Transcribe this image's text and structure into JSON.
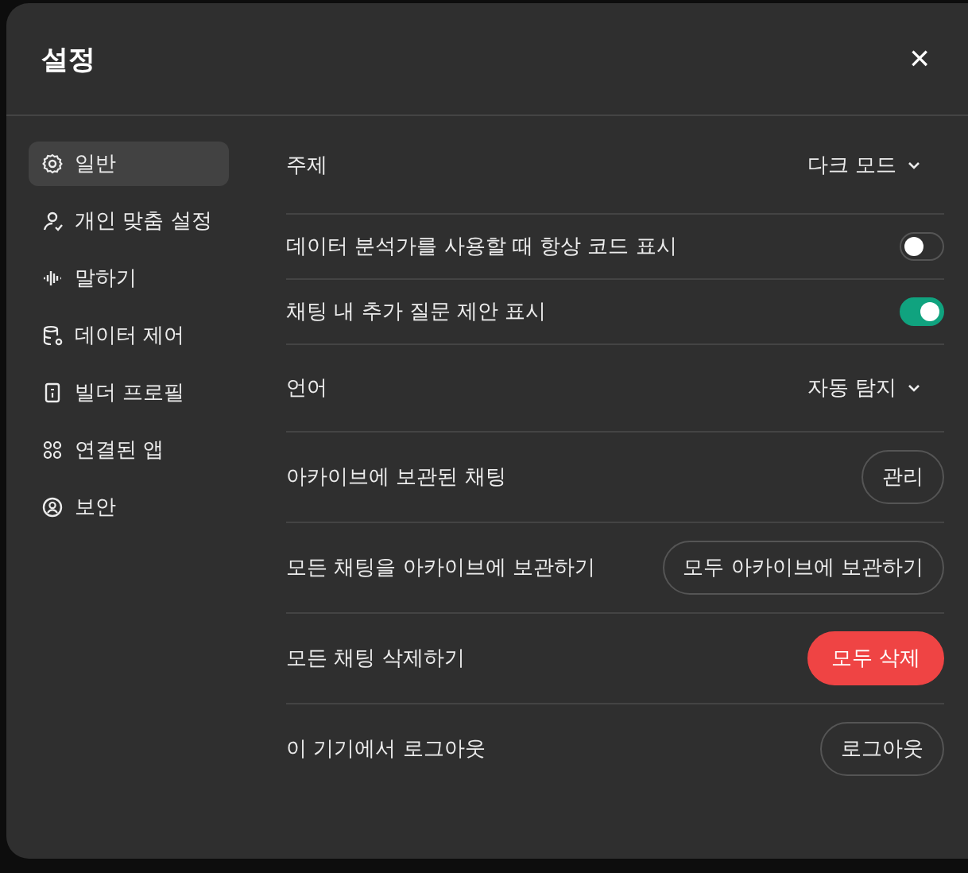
{
  "dialog": {
    "title": "설정",
    "close": "×"
  },
  "sidebar": {
    "items": [
      {
        "label": "일반",
        "kind": "gear",
        "selected": true
      },
      {
        "label": "개인 맞춤 설정",
        "kind": "person",
        "selected": false
      },
      {
        "label": "말하기",
        "kind": "wave",
        "selected": false
      },
      {
        "label": "데이터 제어",
        "kind": "data",
        "selected": false
      },
      {
        "label": "빌더 프로필",
        "kind": "badge",
        "selected": false
      },
      {
        "label": "연결된 앱",
        "kind": "apps",
        "selected": false
      },
      {
        "label": "보안",
        "kind": "shield",
        "selected": false
      }
    ]
  },
  "settings": [
    {
      "kind": "dropdown",
      "label": "주제",
      "value": "다크 모드"
    },
    {
      "kind": "toggle",
      "label": "데이터 분석가를 사용할 때 항상 코드 표시",
      "on": false
    },
    {
      "kind": "toggle",
      "label": "채팅 내 추가 질문 제안 표시",
      "on": true
    },
    {
      "kind": "dropdown",
      "label": "언어",
      "value": "자동 탐지"
    },
    {
      "kind": "button",
      "label": "아카이브에 보관된 채팅",
      "action": "관리"
    },
    {
      "kind": "button",
      "label": "모든 채팅을 아카이브에 보관하기",
      "action": "모두 아카이브에 보관하기"
    },
    {
      "kind": "danger",
      "label": "모든 채팅 삭제하기",
      "action": "모두 삭제"
    },
    {
      "kind": "button",
      "label": "이 기기에서 로그아웃",
      "action": "로그아웃"
    }
  ]
}
